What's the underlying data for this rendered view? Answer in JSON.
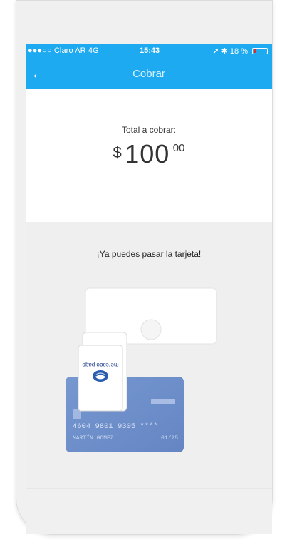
{
  "status_bar": {
    "carrier": "●●●○○ Claro AR  4G",
    "time": "15:43",
    "battery_text": "18 %",
    "battery_level": 0.18
  },
  "nav": {
    "title": "Cobrar",
    "back_icon": "arrow-left-icon"
  },
  "total": {
    "label": "Total a cobrar:",
    "currency": "$",
    "amount_int": "100",
    "amount_cents": "00"
  },
  "instruction": "¡Ya puedes pasar la tarjeta!",
  "card": {
    "number": "4604 9801 9305 ****",
    "holder": "MARTÍN GOMEZ",
    "expiry": "01/25"
  },
  "reader": {
    "brand": "mercado pago"
  },
  "colors": {
    "header": "#1eaaf1",
    "card": "#6d8fc9"
  }
}
